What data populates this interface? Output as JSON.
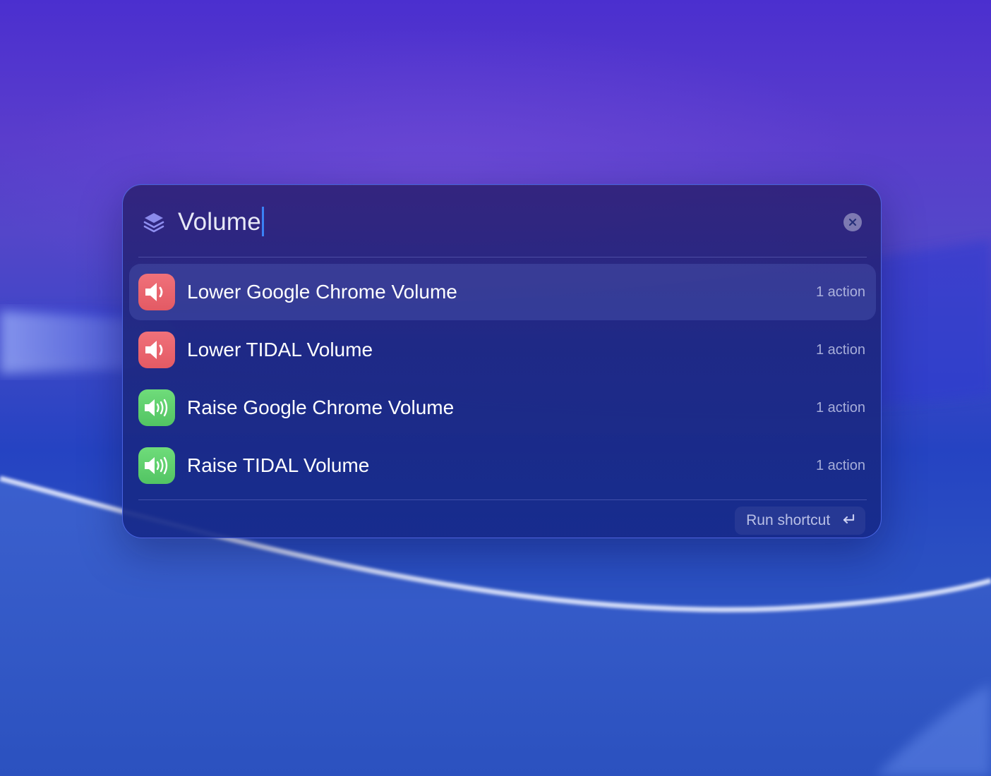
{
  "search": {
    "value": "Volume"
  },
  "results": [
    {
      "title": "Lower Google Chrome Volume",
      "meta": "1 action",
      "icon": "speaker-low-icon",
      "color": "#e85f69",
      "selected": true
    },
    {
      "title": "Lower TIDAL Volume",
      "meta": "1 action",
      "icon": "speaker-low-icon",
      "color": "#e85f69",
      "selected": false
    },
    {
      "title": "Raise Google Chrome Volume",
      "meta": "1 action",
      "icon": "speaker-high-icon",
      "color": "#5bcb6b",
      "selected": false
    },
    {
      "title": "Raise TIDAL Volume",
      "meta": "1 action",
      "icon": "speaker-high-icon",
      "color": "#5bcb6b",
      "selected": false
    }
  ],
  "footer": {
    "run_label": "Run shortcut",
    "run_icon": "return-key-icon"
  },
  "colors": {
    "accent": "#3b82f6",
    "panel_border": "#5a78ff"
  }
}
